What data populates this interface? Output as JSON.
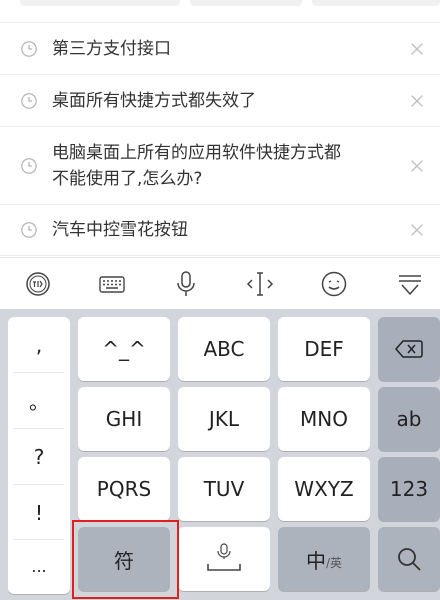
{
  "history": {
    "items": [
      {
        "text": "第三方支付接口"
      },
      {
        "text": "桌面所有快捷方式都失效了"
      },
      {
        "text_line1": "电脑桌面上所有的应用软件快捷方式都",
        "text_line2": "不能使用了,怎么办?"
      },
      {
        "text": "汽车中控雪花按钮"
      }
    ]
  },
  "toolbar": {
    "items": [
      "input-method-logo",
      "keyboard-icon",
      "microphone-icon",
      "cursor-icon",
      "emoji-icon",
      "collapse-keyboard-icon"
    ]
  },
  "keyboard": {
    "punctuation": [
      ",",
      "。",
      "?",
      "!",
      "..."
    ],
    "rows": [
      [
        "^_^",
        "ABC",
        "DEF"
      ],
      [
        "GHI",
        "JKL",
        "MNO"
      ],
      [
        "PQRS",
        "TUV",
        "WXYZ"
      ]
    ],
    "right_keys": {
      "ab": "ab",
      "num": "123"
    },
    "bottom": {
      "symbols": "符",
      "lang_main": "中",
      "lang_sub": "/英"
    }
  },
  "colors": {
    "keyboard_bg": "#d2d5db",
    "key_bg": "#ffffff",
    "key_gray": "#a9afba",
    "highlight": "#e01f1f"
  }
}
